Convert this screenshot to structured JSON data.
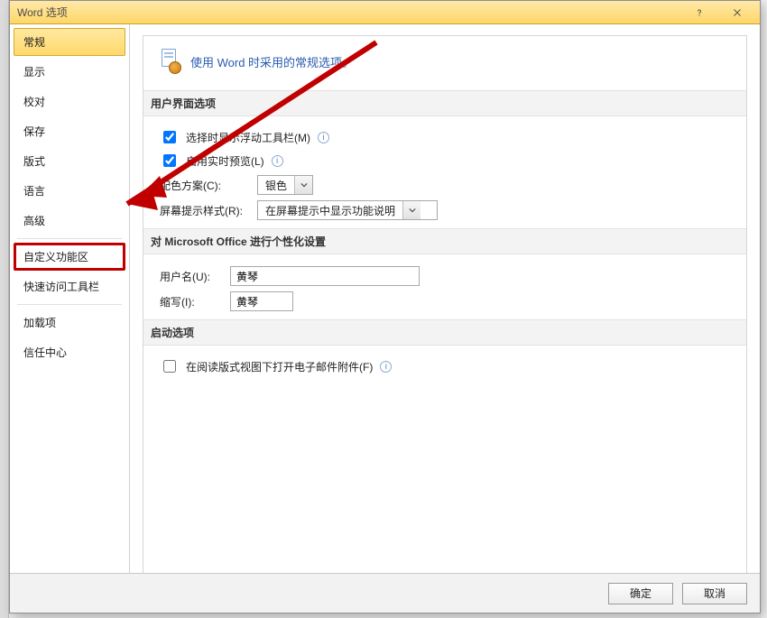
{
  "window": {
    "title": "Word 选项"
  },
  "sidebar": {
    "items": [
      {
        "label": "常规",
        "selected": true
      },
      {
        "label": "显示"
      },
      {
        "label": "校对"
      },
      {
        "label": "保存"
      },
      {
        "label": "版式"
      },
      {
        "label": "语言"
      },
      {
        "label": "高级"
      },
      {
        "label": "自定义功能区",
        "highlighted": true
      },
      {
        "label": "快速访问工具栏"
      },
      {
        "label": "加载项"
      },
      {
        "label": "信任中心"
      }
    ]
  },
  "hero": {
    "text": "使用 Word 时采用的常规选项。"
  },
  "sections": {
    "ui": {
      "title": "用户界面选项",
      "show_mini_toolbar": {
        "label": "选择时显示浮动工具栏(M)",
        "checked": true
      },
      "live_preview": {
        "label": "启用实时预览(L)",
        "checked": true
      },
      "color_scheme": {
        "label": "配色方案(C):",
        "value": "银色"
      },
      "screentip_style": {
        "label": "屏幕提示样式(R):",
        "value": "在屏幕提示中显示功能说明"
      }
    },
    "personalize": {
      "title": "对 Microsoft Office 进行个性化设置",
      "username": {
        "label": "用户名(U):",
        "value": "黄琴"
      },
      "initials": {
        "label": "缩写(I):",
        "value": "黄琴"
      }
    },
    "startup": {
      "title": "启动选项",
      "open_email_in_reading": {
        "label": "在阅读版式视图下打开电子邮件附件(F)",
        "checked": false
      }
    }
  },
  "footer": {
    "ok": "确定",
    "cancel": "取消"
  },
  "icons": {
    "help": "help-icon",
    "close": "close-icon",
    "chevron_down": "chevron-down-icon"
  }
}
